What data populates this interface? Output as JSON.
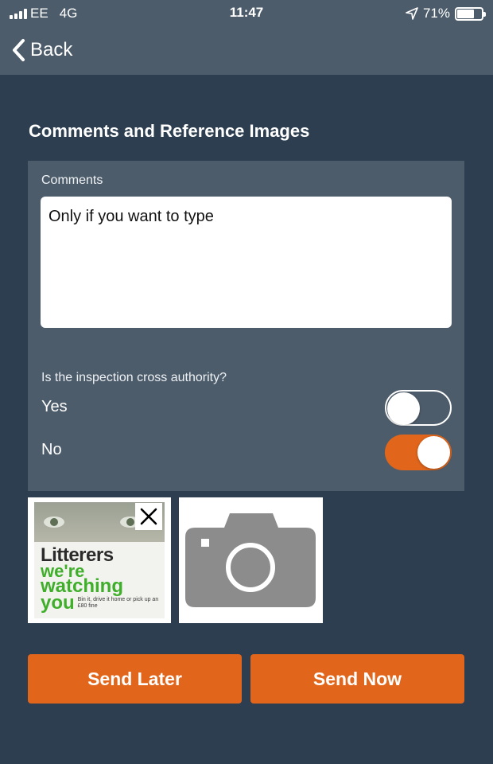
{
  "status_bar": {
    "carrier": "EE",
    "network": "4G",
    "time": "11:47",
    "battery_text": "71%",
    "battery_level": 0.71,
    "location_icon": "location-arrow-icon"
  },
  "nav": {
    "back_label": "Back",
    "back_icon": "chevron-left-icon"
  },
  "section": {
    "title": "Comments and Reference Images"
  },
  "comments": {
    "label": "Comments",
    "value": "Only if you want to type"
  },
  "cross_authority": {
    "question": "Is the inspection cross authority?",
    "options": [
      {
        "label": "Yes",
        "selected": false
      },
      {
        "label": "No",
        "selected": true
      }
    ]
  },
  "images": {
    "thumbnail": {
      "sign_lines": [
        "Litterers",
        "we're",
        "watching",
        "you"
      ],
      "sign_small_text": "Bin it, drive it home or pick up an £80 fine"
    },
    "remove_icon": "close-icon",
    "add_icon": "camera-icon"
  },
  "actions": {
    "send_later": "Send Later",
    "send_now": "Send Now"
  },
  "colors": {
    "background": "#2c3e50",
    "panel": "#4d5c6b",
    "accent": "#e1661b"
  }
}
